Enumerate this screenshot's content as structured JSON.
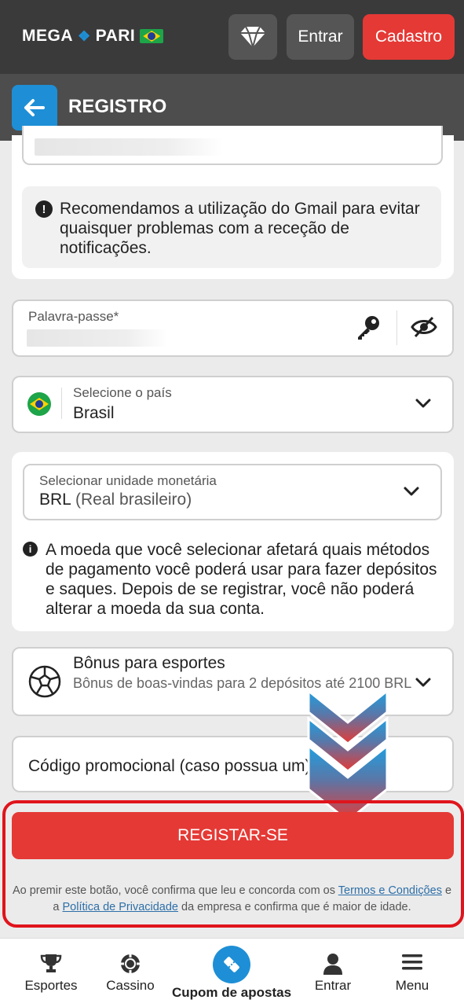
{
  "header": {
    "logo_left": "MEGA",
    "logo_right": "PARI",
    "login_label": "Entrar",
    "signup_label": "Cadastro"
  },
  "subheader": {
    "title": "REGISTRO"
  },
  "email_notice": "Recomendamos a utilização do Gmail para evitar quaisquer problemas com a receção de notificações.",
  "password": {
    "label": "Palavra-passe*"
  },
  "country": {
    "label": "Selecione o país",
    "value": "Brasil"
  },
  "currency": {
    "label": "Selecionar unidade monetária",
    "code": "BRL",
    "name": "(Real brasileiro)",
    "notice": "A moeda que você selecionar afetará quais métodos de pagamento você poderá usar para fazer depósitos e saques. Depois de se registrar, você não poderá alterar a moeda da sua conta."
  },
  "bonus": {
    "title": "Bônus para esportes",
    "description": "Bônus de boas-vindas para 2 depósitos até 2100 BRL"
  },
  "promo": {
    "placeholder": "Código promocional (caso possua um)"
  },
  "submit": {
    "label": "REGISTAR-SE",
    "legal_before": "Ao premir este botão, você confirma que leu e concorda com os ",
    "terms_link": "Termos e Condições",
    "legal_middle": " e a ",
    "privacy_link": "Política de Privacidade",
    "legal_after": " da empresa e confirma que é maior de idade."
  },
  "bottom_nav": [
    {
      "label": "Esportes",
      "icon": "trophy-icon"
    },
    {
      "label": "Cassino",
      "icon": "casino-chip-icon"
    },
    {
      "label": "Cupom de apostas",
      "icon": "ticket-icon"
    },
    {
      "label": "Entrar",
      "icon": "user-icon"
    },
    {
      "label": "Menu",
      "icon": "hamburger-icon"
    }
  ],
  "colors": {
    "accent_red": "#e53935",
    "accent_blue": "#1e8fd6",
    "header_dark": "#3a3a3a"
  }
}
